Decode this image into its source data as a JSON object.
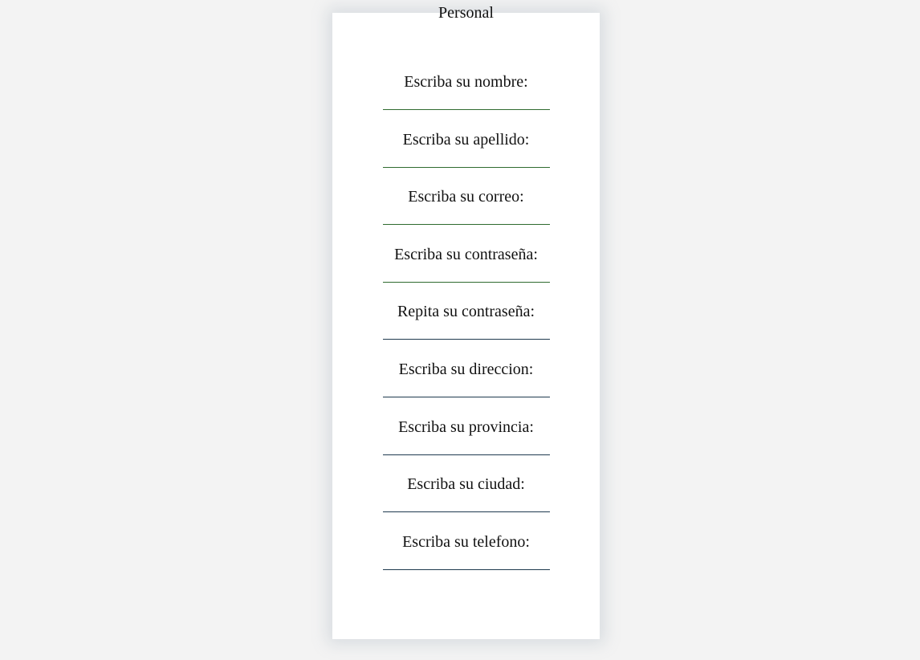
{
  "form": {
    "title": "Personal",
    "fields": [
      {
        "label": "Escriba su nombre:",
        "value": "",
        "line_color": "#2f6b2f"
      },
      {
        "label": "Escriba su apellido:",
        "value": "",
        "line_color": "#2f6b2f"
      },
      {
        "label": "Escriba su correo:",
        "value": "",
        "line_color": "#2f6b2f"
      },
      {
        "label": "Escriba su contraseña:",
        "value": "",
        "line_color": "#2f6b2f"
      },
      {
        "label": "Repita su contraseña:",
        "value": "",
        "line_color": "#1f3a4f"
      },
      {
        "label": "Escriba su direccion:",
        "value": "",
        "line_color": "#1f3a4f"
      },
      {
        "label": "Escriba su provincia:",
        "value": "",
        "line_color": "#1f3a4f"
      },
      {
        "label": "Escriba su ciudad:",
        "value": "",
        "line_color": "#1f3a4f"
      },
      {
        "label": "Escriba su telefono:",
        "value": "",
        "line_color": "#1f3a4f"
      }
    ]
  },
  "colors": {
    "page_background": "#f3f3f3",
    "card_background": "#ffffff"
  }
}
